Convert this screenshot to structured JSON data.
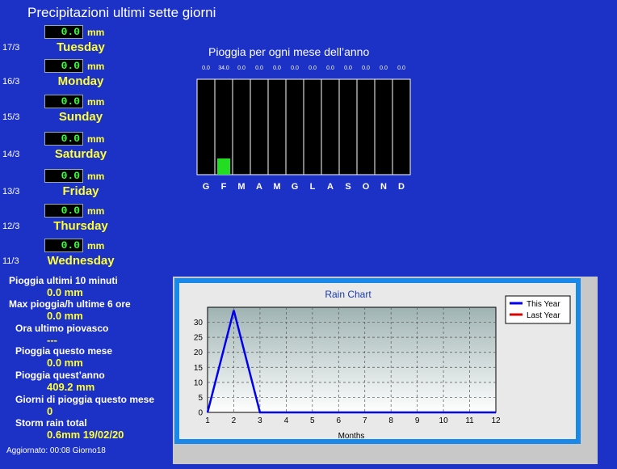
{
  "title": "Precipitazioni  ultimi sette giorni",
  "unit": "mm",
  "days": [
    {
      "date": "17/3",
      "value": "0.0",
      "name": "Tuesday"
    },
    {
      "date": "16/3",
      "value": "0.0",
      "name": "Monday"
    },
    {
      "date": "15/3",
      "value": "0.0",
      "name": "Sunday"
    },
    {
      "date": "14/3",
      "value": "0.0",
      "name": "Saturday"
    },
    {
      "date": "13/3",
      "value": "0.0",
      "name": "Friday"
    },
    {
      "date": "12/3",
      "value": "0.0",
      "name": "Thursday"
    },
    {
      "date": "11/3",
      "value": "0.0",
      "name": "Wednesday"
    }
  ],
  "monthly": {
    "title": "Pioggia per ogni mese dell’anno",
    "value_labels": [
      "0.0",
      "34.0",
      "0.0",
      "0.0",
      "0.0",
      "0.0",
      "0.0",
      "0.0",
      "0.0",
      "0.0",
      "0.0",
      "0.0"
    ],
    "months": [
      "G",
      "F",
      "M",
      "A",
      "M",
      "G",
      "L",
      "A",
      "S",
      "O",
      "N",
      "D"
    ],
    "values": [
      0.0,
      34.0,
      0.0,
      0.0,
      0.0,
      0.0,
      0.0,
      0.0,
      0.0,
      0.0,
      0.0,
      0.0
    ],
    "fill_color": "#22dd22"
  },
  "stats": [
    {
      "label": "Pioggia ultimi 10 minuti",
      "value": "0.0 mm"
    },
    {
      "label": "Max pioggia/h ultime 6 ore",
      "value": "0.0 mm"
    },
    {
      "label": "Ora ultimo piovasco",
      "value": "---"
    },
    {
      "label": "Pioggia questo mese",
      "value": "0.0 mm"
    },
    {
      "label": "Pioggia quest’anno",
      "value": "409.2 mm"
    },
    {
      "label": "Giorni di pioggia questo mese",
      "value": "0"
    },
    {
      "label": "Storm rain total",
      "value": "0.6mm 19/02/20"
    }
  ],
  "updated": "Aggiornato: 00:08 Giorno18",
  "chart_data": {
    "type": "line",
    "title": "Rain Chart",
    "xlabel": "Months",
    "ylabel": "",
    "x": [
      1,
      2,
      3,
      4,
      5,
      6,
      7,
      8,
      9,
      10,
      11,
      12
    ],
    "xlim": [
      1,
      12
    ],
    "ylim": [
      0,
      35
    ],
    "yticks": [
      0,
      5,
      10,
      15,
      20,
      25,
      30
    ],
    "grid": true,
    "legend_position": "top-right",
    "series": [
      {
        "name": "This Year",
        "color": "#0000ee",
        "values": [
          0,
          34,
          0,
          0,
          0,
          0,
          0,
          0,
          0,
          0,
          0,
          0
        ]
      },
      {
        "name": "Last Year",
        "color": "#dd0000",
        "values": []
      }
    ]
  }
}
